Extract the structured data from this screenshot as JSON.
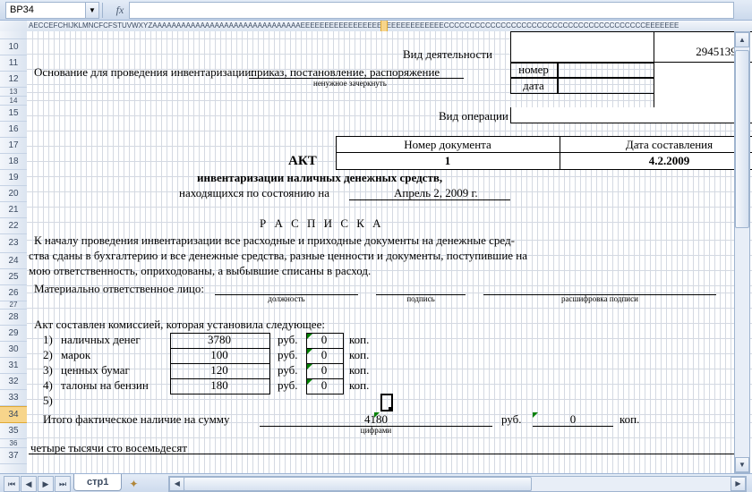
{
  "namebox": "BP34",
  "col_headers_text": "AECCEFCHIJKLMNCFCFSTUVWXYZAAAAAAAAAAAAAAAAAAAAAAAAAAAAAAAEEEEEEEEEEEEEEEEEEEEEEEEEEEEEECCCCCCCCCCCCCCCCCCCCCCCCCCCCCCCCCCCCCCCEEEEEEE",
  "rows": [
    "",
    "10",
    "11",
    "12",
    "13",
    "14",
    "15",
    "16",
    "17",
    "18",
    "19",
    "20",
    "21",
    "22",
    "23",
    "24",
    "25",
    "26",
    "27",
    "28",
    "29",
    "30",
    "31",
    "32",
    "33",
    "34",
    "35",
    "36",
    "37"
  ],
  "sheet_tab": "стр1",
  "doc": {
    "vid_deyat_label": "Вид деятельности",
    "vid_deyat_value": "2945139",
    "osnovanie_label": "Основание для проведения инвентаризации:",
    "osnovanie_value": "приказ,  постановление,  распоряжение",
    "osnovanie_note": "ненужное зачеркнуть",
    "nomer_label": "номер",
    "data_label": "дата",
    "vid_oper_label": "Вид операции",
    "doc_num_label": "Номер документа",
    "doc_date_label": "Дата составления",
    "akt": "АКТ",
    "doc_num": "1",
    "doc_date": "4.2.2009",
    "title1": "инвентаризации наличных денежных средств,",
    "title2_a": "находящихся по состоянию на",
    "title2_b": "Апрель 2, 2009 г.",
    "raspiska": "Р А С П И С К А",
    "para1": "К началу  проведения  инвентаризации  все  расходные  и  приходные  документы  на  денежные  сред-",
    "para2": "ства сданы  в бухгалтерию  и все  денежные  средства,  разные  ценности  и документы, поступившие на",
    "para3": "мою ответственность, оприходованы, а выбывшие списаны в расход.",
    "mo_label": "Материально ответственное лицо:",
    "dolzhnost": "должность",
    "podpis": "подпись",
    "rasshifrovka": "расшифровка подписи",
    "komissia": "Акт составлен комиссией, которая установила следующее:",
    "items": [
      {
        "n": "1)",
        "name": "наличных денег",
        "rub": "3780",
        "kop": "0"
      },
      {
        "n": "2)",
        "name": "марок",
        "rub": "100",
        "kop": "0"
      },
      {
        "n": "3)",
        "name": "ценных бумаг",
        "rub": "120",
        "kop": "0"
      },
      {
        "n": "4)",
        "name": "талоны на бензин",
        "rub": "180",
        "kop": "0"
      },
      {
        "n": "5)",
        "name": "",
        "rub": "",
        "kop": ""
      }
    ],
    "rub_u": "руб.",
    "kop_u": "коп.",
    "itogo": "Итого фактическое наличие на сумму",
    "itogo_rub": "4180",
    "itogo_kop": "0",
    "tsiframi": "цифрами",
    "words": "четыре тысячи сто восемьдесят"
  }
}
